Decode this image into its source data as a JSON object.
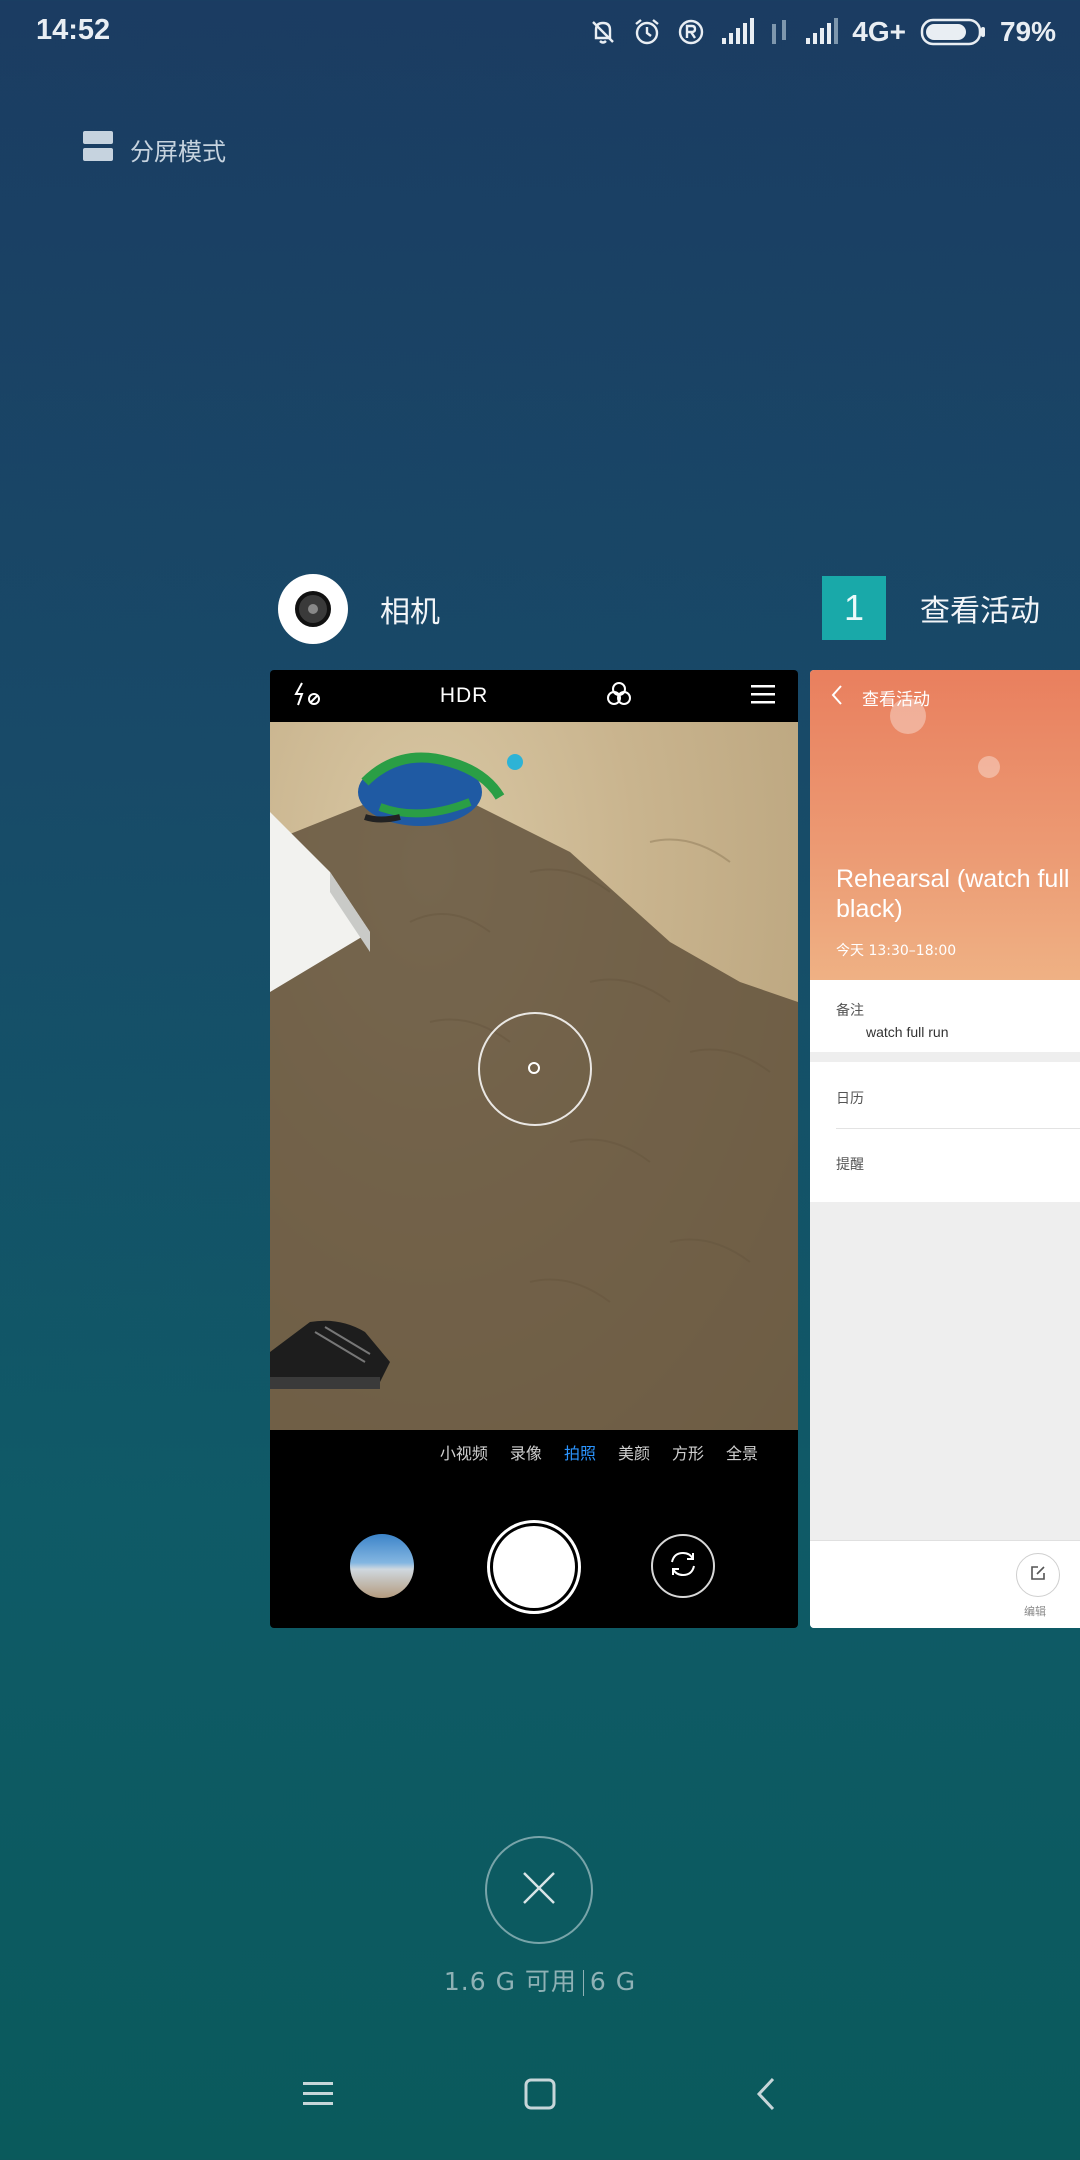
{
  "status_bar": {
    "time": "14:52",
    "network": "4G+",
    "battery_percent": "79%",
    "battery_level": 0.79,
    "icons": [
      "bell-muted-icon",
      "alarm-icon",
      "roaming-r-icon",
      "signal-icon",
      "data-arrows-icon",
      "signal-icon",
      "battery-icon"
    ]
  },
  "split_screen": {
    "label": "分屏模式",
    "icon": "split-screen-icon"
  },
  "cards": [
    {
      "app": "相机",
      "icon": "camera-app-icon",
      "camera": {
        "top_icons": [
          "flash-off-icon",
          "hdr-icon",
          "filter-icon",
          "menu-icon"
        ],
        "hdr_label": "HDR",
        "modes": [
          "小视频",
          "录像",
          "拍照",
          "美颜",
          "方形",
          "全景"
        ],
        "active_mode": "拍照"
      }
    },
    {
      "app": "查看活动",
      "badge": "1",
      "event": {
        "header": "查看活动",
        "title": "Rehearsal (watch full black)",
        "time": "今天 13:30–18:00",
        "note_label": "备注",
        "note_value": "watch full run",
        "calendar_label": "日历",
        "reminder_label": "提醒",
        "edit_label": "编辑"
      }
    }
  ],
  "memory": {
    "available": "1.6 G 可用",
    "total": "6 G"
  },
  "nav": {
    "items": [
      "menu-icon",
      "home-icon",
      "back-icon"
    ]
  },
  "colors": {
    "accent_blue": "#2b95ff",
    "calendar_orange": "#e97f5e",
    "teal_badge": "#19a9a9"
  }
}
